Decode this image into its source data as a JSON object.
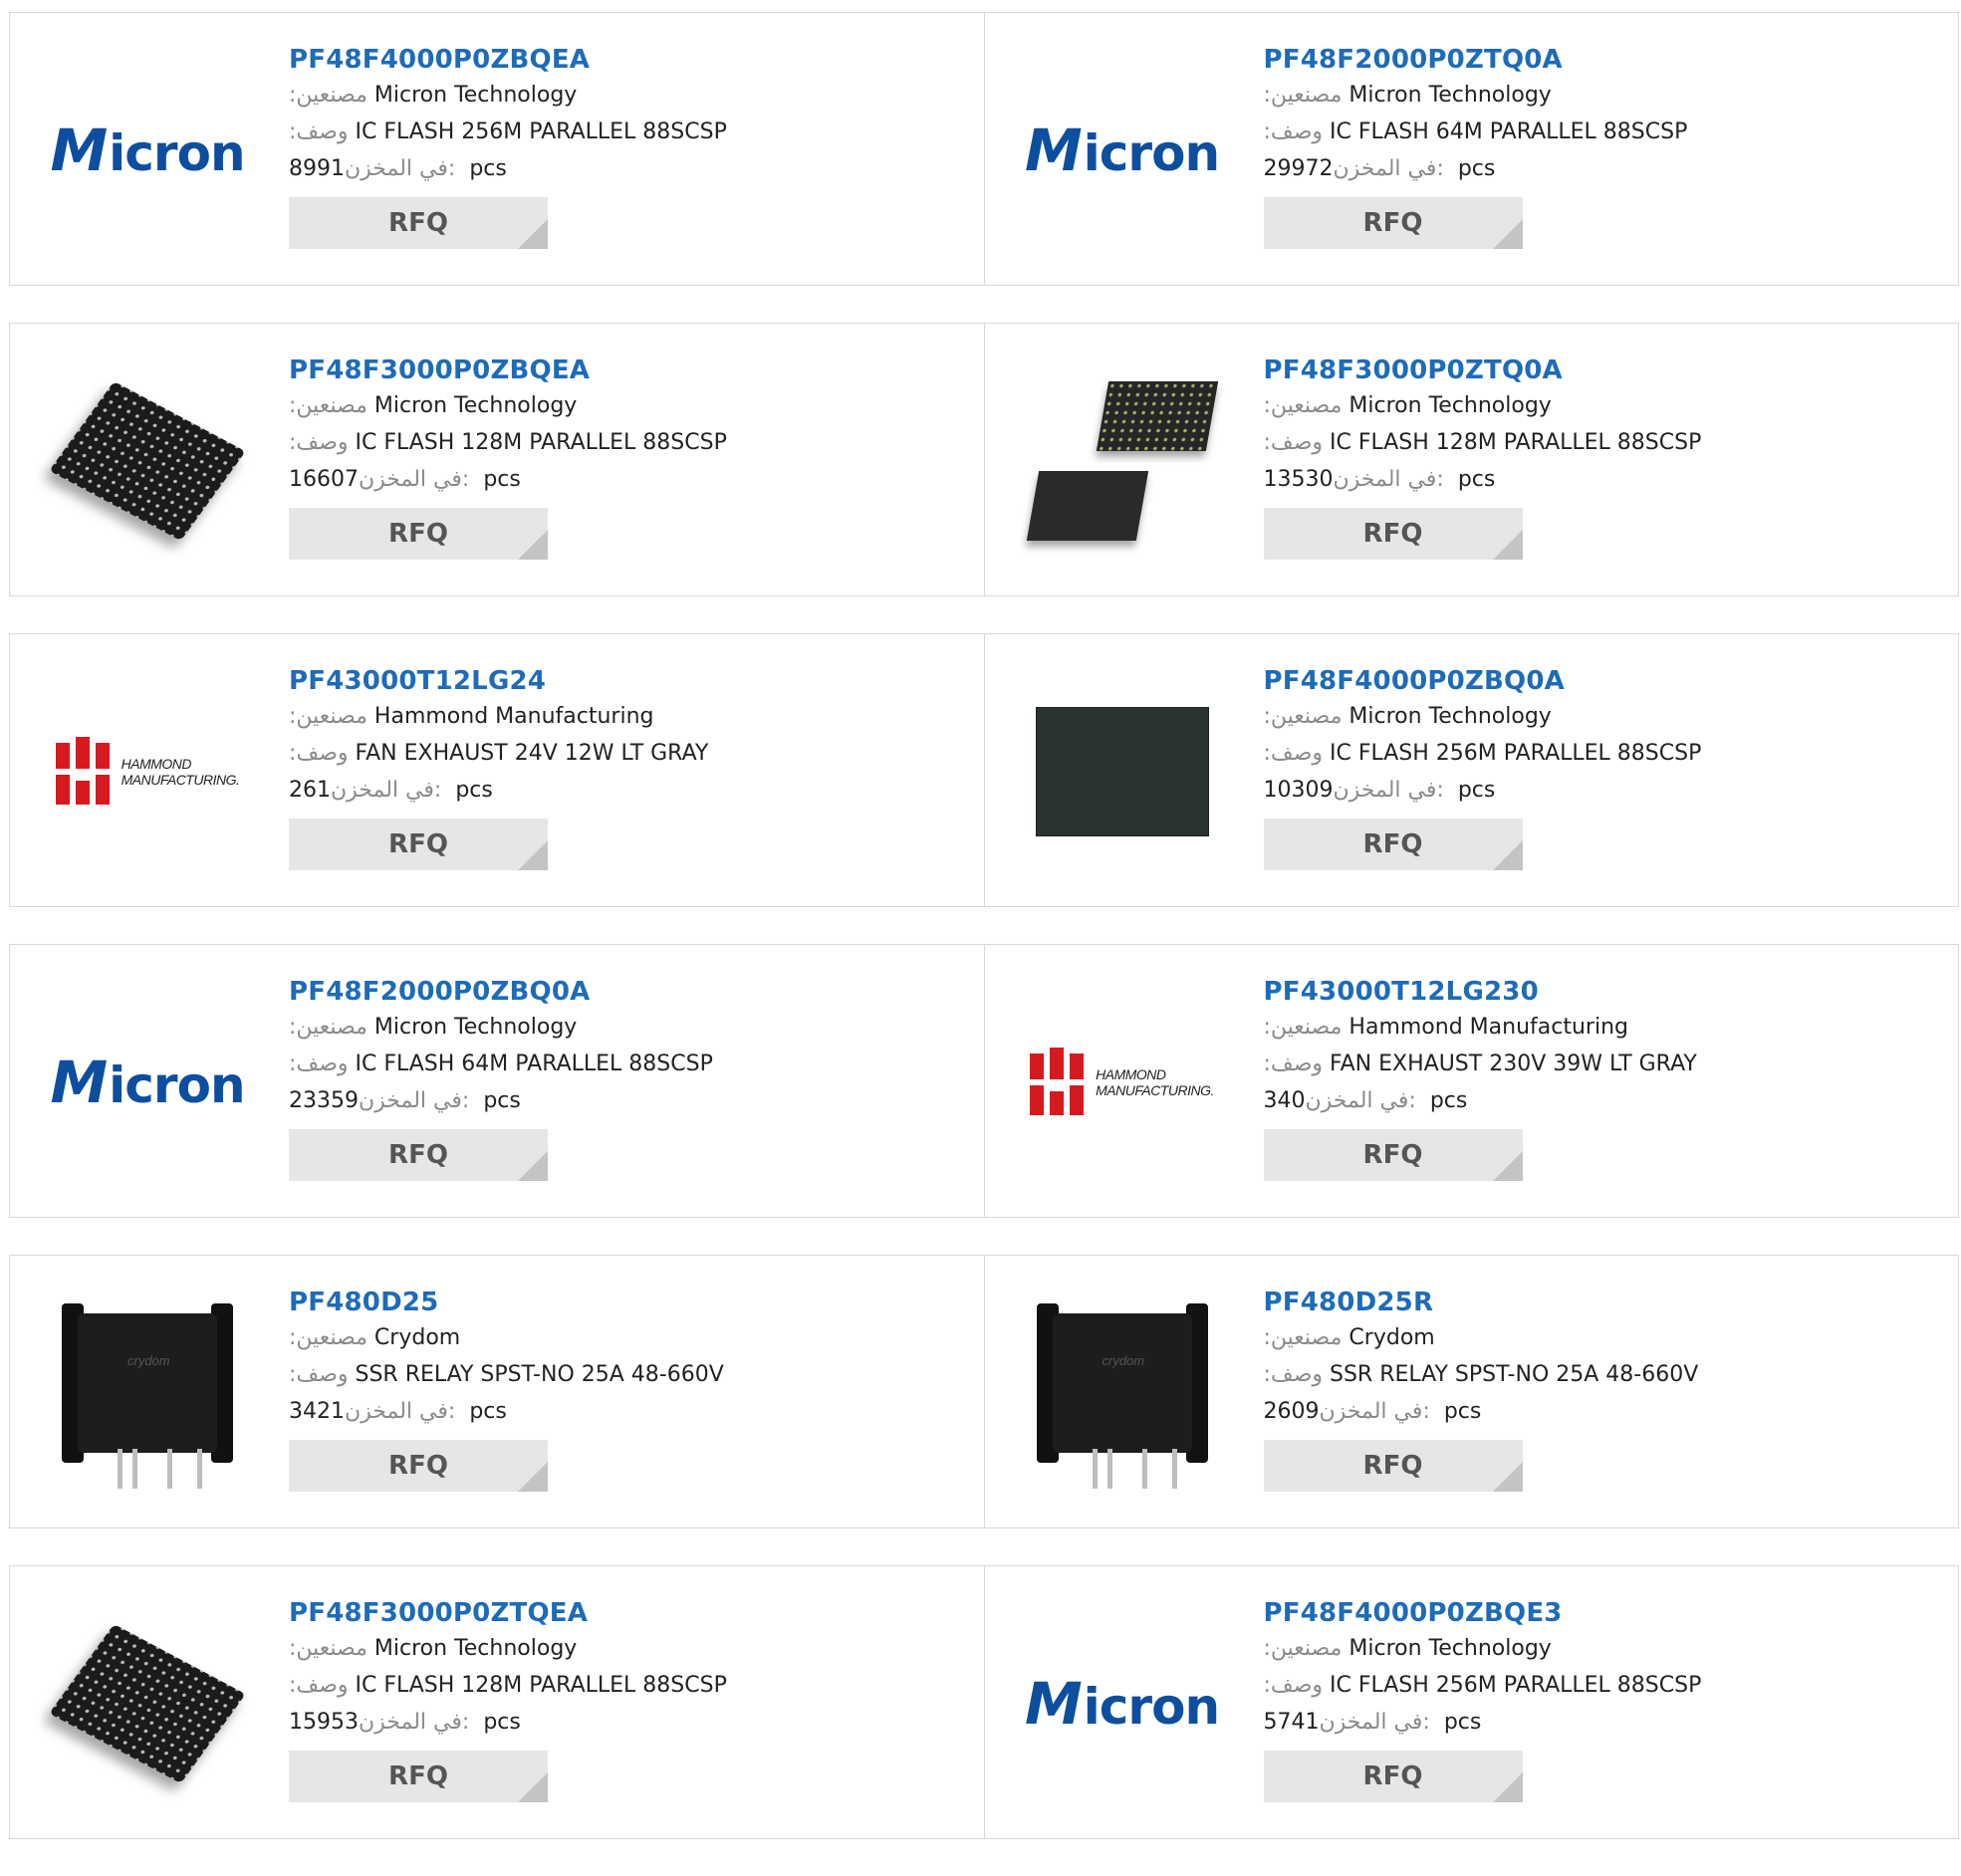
{
  "labels": {
    "manufacturer": ":مصنعين",
    "description": ":وصف",
    "stock": "في المخزن:",
    "pcs": "pcs",
    "rfq": "RFQ"
  },
  "products": [
    {
      "pn": "PF48F4000P0ZBQEA",
      "mfr": "Micron Technology",
      "desc": "IC FLASH 256M PARALLEL 88SCSP",
      "stock": "8991",
      "image": "micron-logo"
    },
    {
      "pn": "PF48F2000P0ZTQ0A",
      "mfr": "Micron Technology",
      "desc": "IC FLASH 64M PARALLEL 88SCSP",
      "stock": "29972",
      "image": "micron-logo"
    },
    {
      "pn": "PF48F3000P0ZBQEA",
      "mfr": "Micron Technology",
      "desc": "IC FLASH 128M PARALLEL 88SCSP",
      "stock": "16607",
      "image": "bga-chip"
    },
    {
      "pn": "PF48F3000P0ZTQ0A",
      "mfr": "Micron Technology",
      "desc": "IC FLASH 128M PARALLEL 88SCSP",
      "stock": "13530",
      "image": "bga-chip-pair"
    },
    {
      "pn": "PF43000T12LG24",
      "mfr": "Hammond Manufacturing",
      "desc": "FAN EXHAUST 24V 12W LT GRAY",
      "stock": "261",
      "image": "hammond-logo"
    },
    {
      "pn": "PF48F4000P0ZBQ0A",
      "mfr": "Micron Technology",
      "desc": "IC FLASH 256M PARALLEL 88SCSP",
      "stock": "10309",
      "image": "square-chip"
    },
    {
      "pn": "PF48F2000P0ZBQ0A",
      "mfr": "Micron Technology",
      "desc": "IC FLASH 64M PARALLEL 88SCSP",
      "stock": "23359",
      "image": "micron-logo"
    },
    {
      "pn": "PF43000T12LG230",
      "mfr": "Hammond Manufacturing",
      "desc": "FAN EXHAUST 230V 39W LT GRAY",
      "stock": "340",
      "image": "hammond-logo"
    },
    {
      "pn": "PF480D25",
      "mfr": "Crydom",
      "desc": "SSR RELAY SPST-NO 25A 48-660V",
      "stock": "3421",
      "image": "relay"
    },
    {
      "pn": "PF480D25R",
      "mfr": "Crydom",
      "desc": "SSR RELAY SPST-NO 25A 48-660V",
      "stock": "2609",
      "image": "relay"
    },
    {
      "pn": "PF48F3000P0ZTQEA",
      "mfr": "Micron Technology",
      "desc": "IC FLASH 128M PARALLEL 88SCSP",
      "stock": "15953",
      "image": "bga-chip"
    },
    {
      "pn": "PF48F4000P0ZBQE3",
      "mfr": "Micron Technology",
      "desc": "IC FLASH 256M PARALLEL 88SCSP",
      "stock": "5741",
      "image": "micron-logo"
    }
  ],
  "logo_text": {
    "micron": "Micron",
    "hammond_line1": "HAMMOND",
    "hammond_line2": "MANUFACTURING.",
    "crydom": "crydom"
  },
  "colors": {
    "link": "#1e6bb8",
    "rfq_bg": "#e6e6e6",
    "border": "#d9d9d9",
    "micron_blue": "#0d4f9e",
    "hammond_red": "#d71920"
  }
}
